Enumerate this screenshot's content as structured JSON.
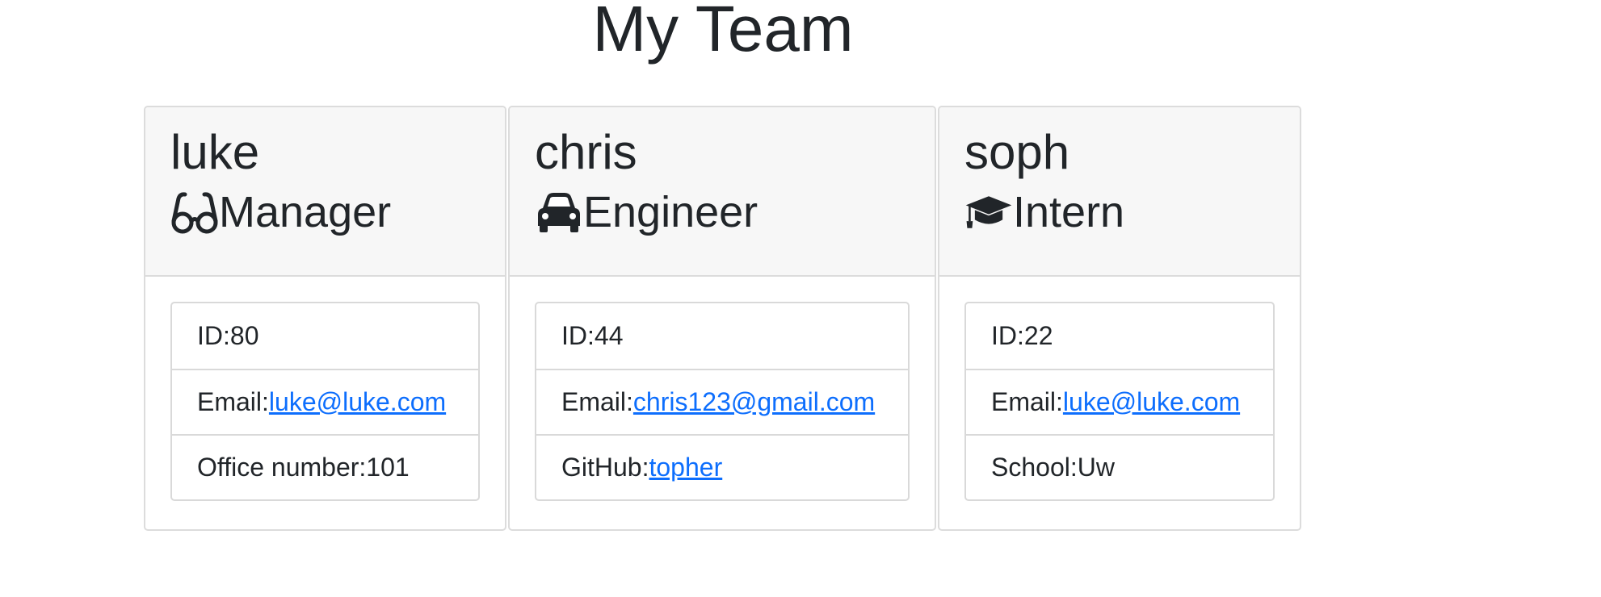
{
  "page": {
    "title": "My Team"
  },
  "team": [
    {
      "name": "luke",
      "role": "Manager",
      "role_icon": "glasses-icon",
      "id_label": "ID: ",
      "id": "80",
      "email_label": "Email: ",
      "email": "luke@luke.com",
      "extra_label": "Office number: ",
      "extra": "101"
    },
    {
      "name": "chris",
      "role": "Engineer",
      "role_icon": "car-icon",
      "id_label": "ID: ",
      "id": "44",
      "email_label": "Email: ",
      "email": "chris123@gmail.com",
      "extra_label": "GitHub: ",
      "extra": "topher"
    },
    {
      "name": "soph",
      "role": "Intern",
      "role_icon": "graduation-cap-icon",
      "id_label": "ID: ",
      "id": "22",
      "email_label": "Email: ",
      "email": "luke@luke.com",
      "extra_label": "School: ",
      "extra": "Uw"
    }
  ],
  "colors": {
    "link": "#0d6efd",
    "text": "#212529",
    "header_bg": "#f7f7f7",
    "border": "#dcdcdc"
  }
}
